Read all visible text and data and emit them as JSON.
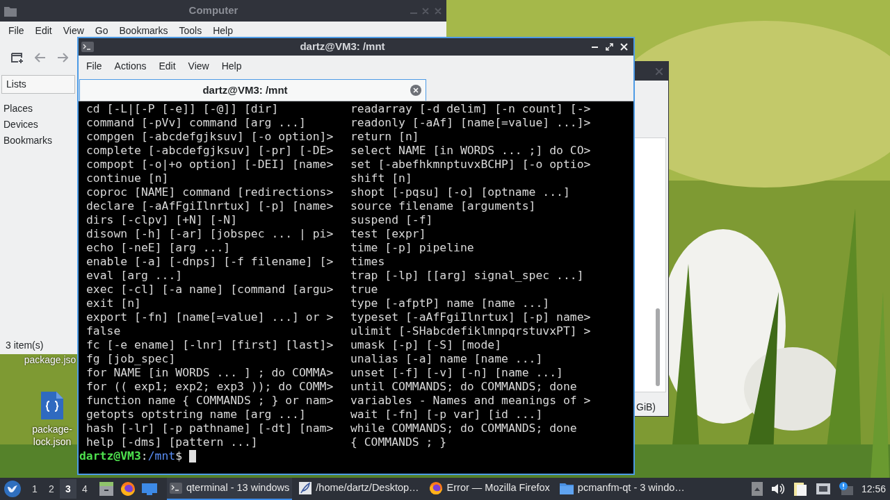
{
  "desktop": {
    "icons": [
      {
        "label": "package.jso",
        "kind": "hidden"
      },
      {
        "label": "package-lock.json",
        "kind": "json"
      }
    ]
  },
  "file_manager": {
    "title": "Computer",
    "menu": [
      "File",
      "Edit",
      "View",
      "Go",
      "Bookmarks",
      "Tools",
      "Help"
    ],
    "sidebar": {
      "dropdown": "Lists",
      "items": [
        "Places",
        "Devices",
        "Bookmarks"
      ]
    },
    "status": "3 item(s)"
  },
  "back_window": {
    "status": "GiB)"
  },
  "terminal": {
    "title": "dartz@VM3: /mnt",
    "menu": [
      "File",
      "Actions",
      "Edit",
      "View",
      "Help"
    ],
    "tabs": [
      {
        "label": "dartz@VM3: /mnt",
        "selected": true
      }
    ],
    "columns": [
      [
        "cd [-L|[-P [-e]] [-@]] [dir]",
        "command [-pVv] command [arg ...]",
        "compgen [-abcdefgjksuv] [-o option]>",
        "complete [-abcdefgjksuv] [-pr] [-DE>",
        "compopt [-o|+o option] [-DEI] [name>",
        "continue [n]",
        "coproc [NAME] command [redirections>",
        "declare [-aAfFgiIlnrtux] [-p] [name>",
        "dirs [-clpv] [+N] [-N]",
        "disown [-h] [-ar] [jobspec ... | pi>",
        "echo [-neE] [arg ...]",
        "enable [-a] [-dnps] [-f filename] [>",
        "eval [arg ...]",
        "exec [-cl] [-a name] [command [argu>",
        "exit [n]",
        "export [-fn] [name[=value] ...] or >",
        "false",
        "fc [-e ename] [-lnr] [first] [last]>",
        "fg [job_spec]",
        "for NAME [in WORDS ... ] ; do COMMA>",
        "for (( exp1; exp2; exp3 )); do COMM>",
        "function name { COMMANDS ; } or nam>",
        "getopts optstring name [arg ...]",
        "hash [-lr] [-p pathname] [-dt] [nam>",
        "help [-dms] [pattern ...]"
      ],
      [
        "readarray [-d delim] [-n count] [->",
        "readonly [-aAf] [name[=value] ...]>",
        "return [n]",
        "select NAME [in WORDS ... ;] do CO>",
        "set [-abefhkmnptuvxBCHP] [-o optio>",
        "shift [n]",
        "shopt [-pqsu] [-o] [optname ...]",
        "source filename [arguments]",
        "suspend [-f]",
        "test [expr]",
        "time [-p] pipeline",
        "times",
        "trap [-lp] [[arg] signal_spec ...]",
        "true",
        "type [-afptP] name [name ...]",
        "typeset [-aAfFgiIlnrtux] [-p] name>",
        "ulimit [-SHabcdefiklmnpqrstuvxPT] >",
        "umask [-p] [-S] [mode]",
        "unalias [-a] name [name ...]",
        "unset [-f] [-v] [-n] [name ...]",
        "until COMMANDS; do COMMANDS; done",
        "variables - Names and meanings of >",
        "wait [-fn] [-p var] [id ...]",
        "while COMMANDS; do COMMANDS; done",
        "{ COMMANDS ; }"
      ]
    ],
    "prompt": {
      "user_host": "dartz@VM3",
      "separator": ":",
      "path": "/mnt",
      "symbol": "$"
    }
  },
  "taskbar": {
    "workspaces": [
      {
        "label": "1",
        "selected": false
      },
      {
        "label": "2",
        "selected": false
      },
      {
        "label": "3",
        "selected": true
      },
      {
        "label": "4",
        "selected": false
      }
    ],
    "tasks": [
      {
        "label": "qterminal - 13 windows",
        "kind": "terminal",
        "selected": true
      },
      {
        "label": "/home/dartz/Desktop…",
        "kind": "editor",
        "selected": false
      },
      {
        "label": "Error — Mozilla Firefox",
        "kind": "browser",
        "selected": false
      },
      {
        "label": "pcmanfm-qt - 3 windo…",
        "kind": "folder",
        "selected": false
      }
    ],
    "clock": "12:56"
  }
}
